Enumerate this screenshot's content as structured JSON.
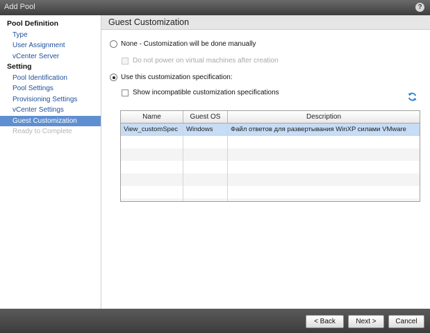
{
  "window": {
    "title": "Add Pool",
    "help_icon": "help-icon",
    "help_glyph": "?"
  },
  "sidebar": {
    "sections": [
      {
        "label": "Pool Definition",
        "items": [
          {
            "label": "Type",
            "state": "normal"
          },
          {
            "label": "User Assignment",
            "state": "normal"
          },
          {
            "label": "vCenter Server",
            "state": "normal"
          }
        ]
      },
      {
        "label": "Setting",
        "items": [
          {
            "label": "Pool Identification",
            "state": "normal"
          },
          {
            "label": "Pool Settings",
            "state": "normal"
          },
          {
            "label": "Provisioning Settings",
            "state": "normal"
          },
          {
            "label": "vCenter Settings",
            "state": "normal"
          },
          {
            "label": "Guest Customization",
            "state": "active"
          },
          {
            "label": "Ready to Complete",
            "state": "disabled"
          }
        ]
      }
    ]
  },
  "main": {
    "header": "Guest Customization",
    "option_none": {
      "label": "None - Customization will be done manually",
      "checked": false
    },
    "no_power_on": {
      "label": "Do not power on virtual machines after creation",
      "checked": false,
      "enabled": false
    },
    "option_spec": {
      "label": "Use this customization specification:",
      "checked": true
    },
    "show_incompatible": {
      "label": "Show incompatible customization specifications",
      "checked": false
    },
    "refresh_icon": "refresh-icon",
    "table": {
      "columns": [
        "Name",
        "Guest OS",
        "Description"
      ],
      "rows": [
        {
          "name": "View_customSpec",
          "guest_os": "Windows",
          "description": "Файл ответов для развертывания WinXP силами VMware",
          "selected": true
        }
      ],
      "empty_rows": 6
    }
  },
  "footer": {
    "back": "< Back",
    "next": "Next >",
    "cancel": "Cancel"
  },
  "colors": {
    "accent": "#5f8fd0",
    "link": "#1e4f9a",
    "selection": "#c7dcf5",
    "frame": "#4a4a4a"
  }
}
